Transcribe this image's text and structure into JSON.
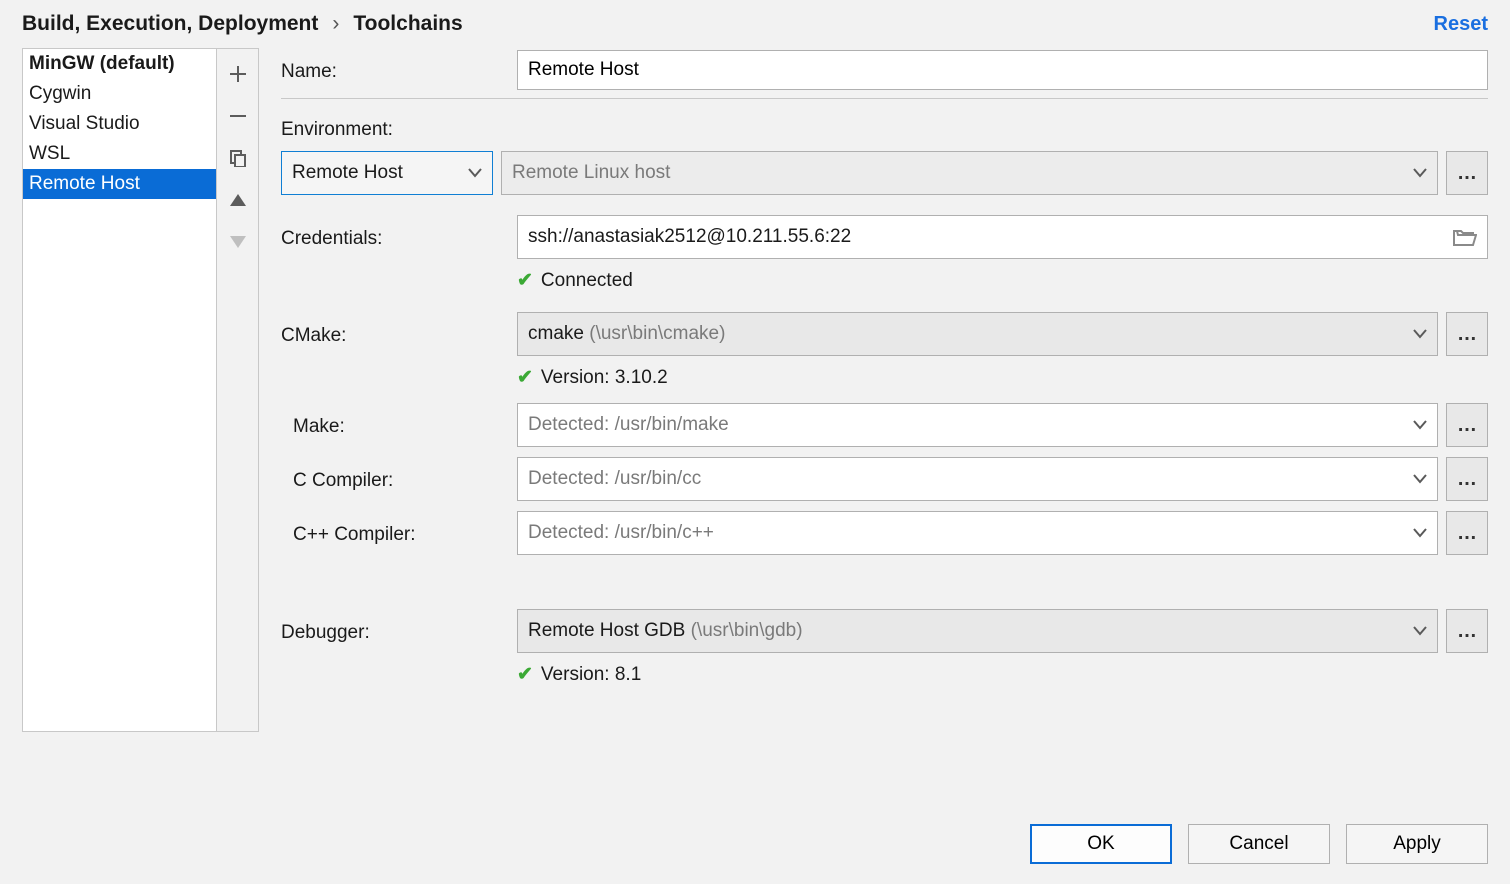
{
  "breadcrumb": {
    "parent": "Build, Execution, Deployment",
    "current": "Toolchains"
  },
  "reset_label": "Reset",
  "toolchains": {
    "items": [
      {
        "label": "MinGW (default)",
        "default": true,
        "selected": false
      },
      {
        "label": "Cygwin",
        "default": false,
        "selected": false
      },
      {
        "label": "Visual Studio",
        "default": false,
        "selected": false
      },
      {
        "label": "WSL",
        "default": false,
        "selected": false
      },
      {
        "label": "Remote Host",
        "default": false,
        "selected": true
      }
    ]
  },
  "form": {
    "name_label": "Name:",
    "name_value": "Remote Host",
    "environment_label": "Environment:",
    "environment_value": "Remote Host",
    "host_placeholder": "Remote Linux host",
    "credentials_label": "Credentials:",
    "credentials_value": "ssh://anastasiak2512@10.211.55.6:22",
    "connected_status": "Connected",
    "cmake_label": "CMake:",
    "cmake_name": "cmake",
    "cmake_path": "(\\usr\\bin\\cmake)",
    "cmake_version": "Version: 3.10.2",
    "make_label": "Make:",
    "make_placeholder": "Detected: /usr/bin/make",
    "c_compiler_label": "C Compiler:",
    "c_compiler_placeholder": "Detected: /usr/bin/cc",
    "cpp_compiler_label": "C++ Compiler:",
    "cpp_compiler_placeholder": "Detected: /usr/bin/c++",
    "debugger_label": "Debugger:",
    "debugger_name": "Remote Host GDB",
    "debugger_path": "(\\usr\\bin\\gdb)",
    "debugger_version": "Version: 8.1"
  },
  "buttons": {
    "ok": "OK",
    "cancel": "Cancel",
    "apply": "Apply"
  }
}
